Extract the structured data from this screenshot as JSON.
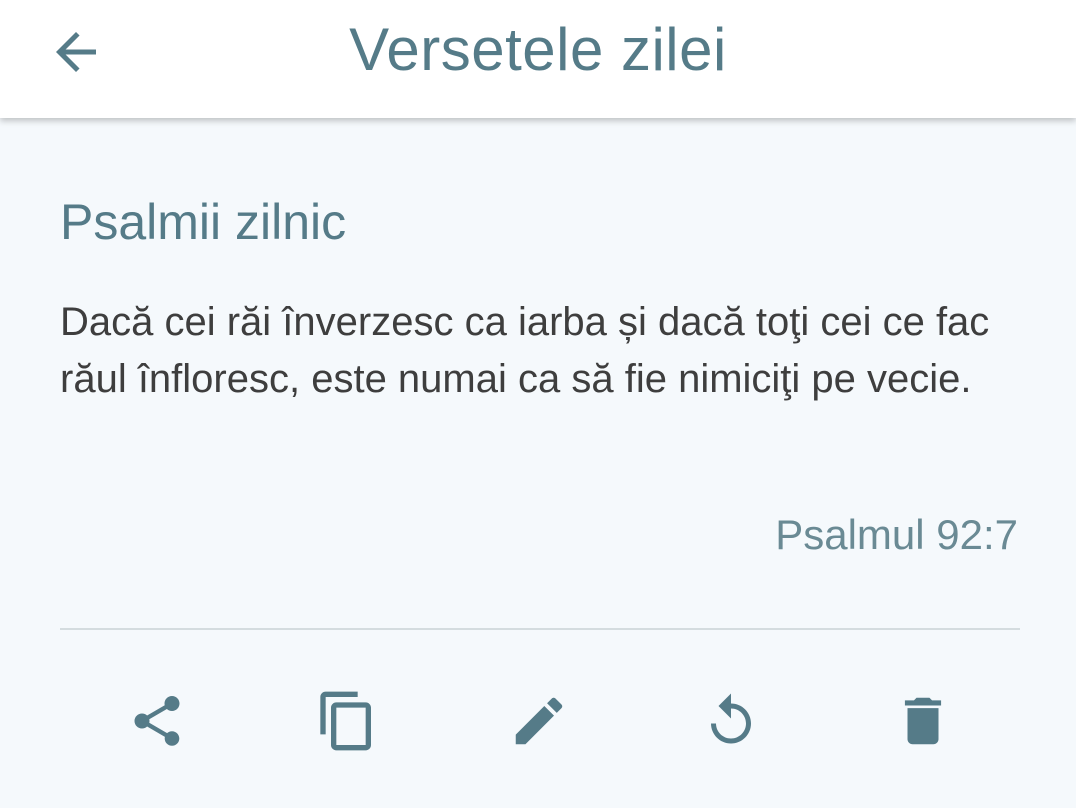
{
  "app_bar": {
    "title": "Versetele zilei",
    "back_icon": "arrow-left-icon"
  },
  "card": {
    "section_title": "Psalmii zilnic",
    "verse_text": "Dacă cei răi înverzesc ca iarba și dacă toţi cei ce fac răul înfloresc, este numai ca să fie nimiciţi pe vecie.",
    "reference": "Psalmul 92:7"
  },
  "actions": [
    {
      "icon": "share-icon"
    },
    {
      "icon": "copy-icon"
    },
    {
      "icon": "edit-icon"
    },
    {
      "icon": "refresh-icon"
    },
    {
      "icon": "delete-icon"
    }
  ],
  "colors": {
    "accent": "#557b88",
    "text": "#3e3e3e",
    "background": "#f5f9fc",
    "icon": "#557b88"
  }
}
